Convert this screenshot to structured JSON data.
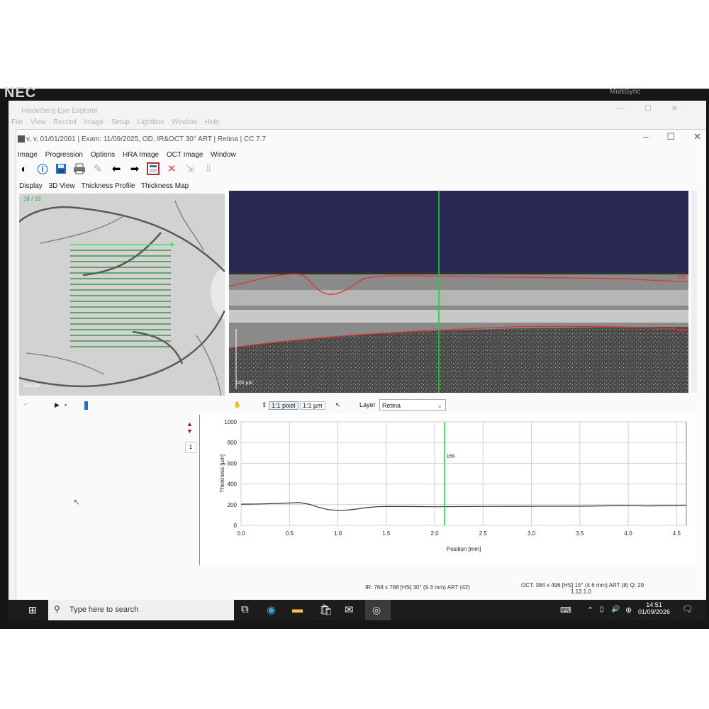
{
  "monitor": {
    "brand": "NEC",
    "model": "MultiSync"
  },
  "outer_window": {
    "title": "Heidelberg Eye Explorer",
    "menu": [
      "File",
      "View",
      "Record",
      "Image",
      "Setup",
      "Lightbox",
      "Window",
      "Help"
    ]
  },
  "inner_window": {
    "title": "v, v, 01/01/2001  |  Exam: 11/09/2025, OD, IR&OCT 30° ART  |  Retina  |  CC 7.7",
    "menu": [
      "Image",
      "Progression",
      "Options",
      "HRA Image",
      "OCT Image",
      "Window"
    ],
    "view_tabs": [
      "Display",
      "3D View",
      "Thickness Profile",
      "Thickness Map"
    ],
    "toolbar_icons": [
      "contrast-icon",
      "info-icon",
      "save-icon",
      "print-icon",
      "edit-icon",
      "arrow-left-icon",
      "arrow-right-icon",
      "report-icon",
      "delete-icon",
      "export-icon",
      "import-icon"
    ]
  },
  "ir_image": {
    "counter": "18 / 19",
    "scale": "200 µm"
  },
  "oct_image": {
    "scale": "200 µm",
    "ilm_label": "ILM",
    "bm_label": "BM"
  },
  "controls": {
    "pixel_button": "1:1 pixel",
    "micron_button": "1:1 µm",
    "layer_label": "Layer",
    "layer_value": "Retina",
    "list_number": "1"
  },
  "chart_data": {
    "type": "line",
    "xlabel": "Position [mm]",
    "ylabel": "Thickness [µm]",
    "xlim": [
      0.0,
      4.6
    ],
    "ylim": [
      0,
      1000
    ],
    "xticks": [
      "0.0",
      "0.5",
      "1.0",
      "1.5",
      "2.0",
      "2.5",
      "3.0",
      "3.5",
      "4.0",
      "4.5"
    ],
    "yticks": [
      "0",
      "200",
      "400",
      "600",
      "800",
      "1000"
    ],
    "grid": true,
    "cursor_x": 2.1,
    "cursor_label": "169",
    "series": [
      {
        "x": [
          0.0,
          0.2,
          0.4,
          0.6,
          0.7,
          0.8,
          0.9,
          1.0,
          1.1,
          1.2,
          1.3,
          1.4,
          1.5,
          1.7,
          2.0,
          2.5,
          3.0,
          3.5,
          4.0,
          4.2,
          4.5,
          4.6
        ],
        "y": [
          205,
          207,
          212,
          220,
          205,
          175,
          152,
          145,
          148,
          158,
          172,
          180,
          183,
          182,
          180,
          183,
          184,
          185,
          192,
          188,
          192,
          193
        ]
      }
    ]
  },
  "status": {
    "ir": "IR: 768 x 768 [HS] 30° (9.3 mm) ART (42)",
    "oct": "OCT: 384 x 496 [HS] 15° (4.6 mm) ART (8) Q: 29",
    "version": "1.12.1.0"
  },
  "taskbar": {
    "search_placeholder": "Type here to search",
    "time": "14:51",
    "date": "01/09/2026"
  },
  "colors": {
    "grid": "#cfcfcf",
    "cursor": "#22cc44",
    "segmentation": "#e03030"
  }
}
